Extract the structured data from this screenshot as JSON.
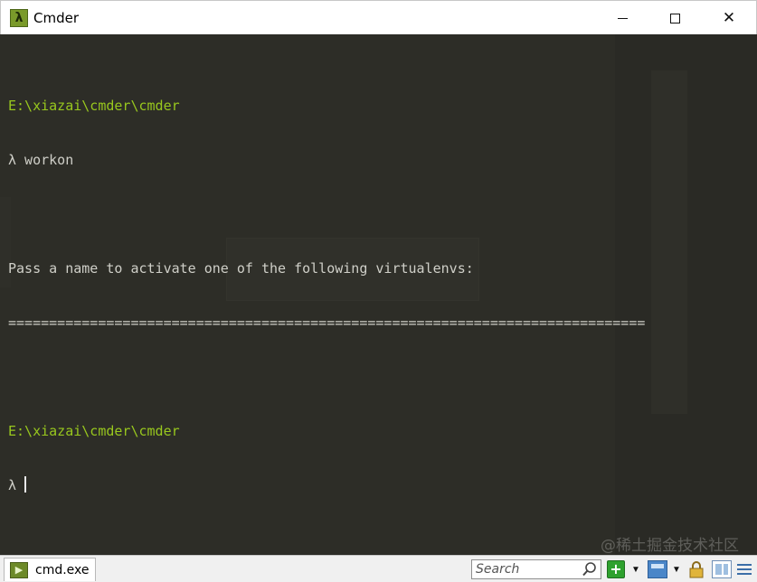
{
  "window": {
    "title": "Cmder",
    "app_icon_glyph": "λ",
    "controls": {
      "minimize": "minimize-icon",
      "maximize": "maximize-icon",
      "close": "close-icon"
    }
  },
  "console": {
    "path_color": "#98c71e",
    "background": "#2d2d27",
    "lines": {
      "l0": "",
      "l1_path": "E:\\xiazai\\cmder\\cmder",
      "l2": "λ workon",
      "l3": "",
      "l4": "Pass a name to activate one of the following virtualenvs:",
      "l5": "==============================================================================",
      "l6": "",
      "l7_path": "E:\\xiazai\\cmder\\cmder",
      "l8_prompt": "λ "
    },
    "watermark": "@稀土掘金技术社区"
  },
  "statusbar": {
    "tab_label": "cmd.exe",
    "search_placeholder": "Search",
    "icons": [
      "new-console-icon",
      "dropdown-icon",
      "window-icon",
      "dropdown-icon",
      "lock-icon",
      "split-panes-icon",
      "menu-icon"
    ]
  }
}
